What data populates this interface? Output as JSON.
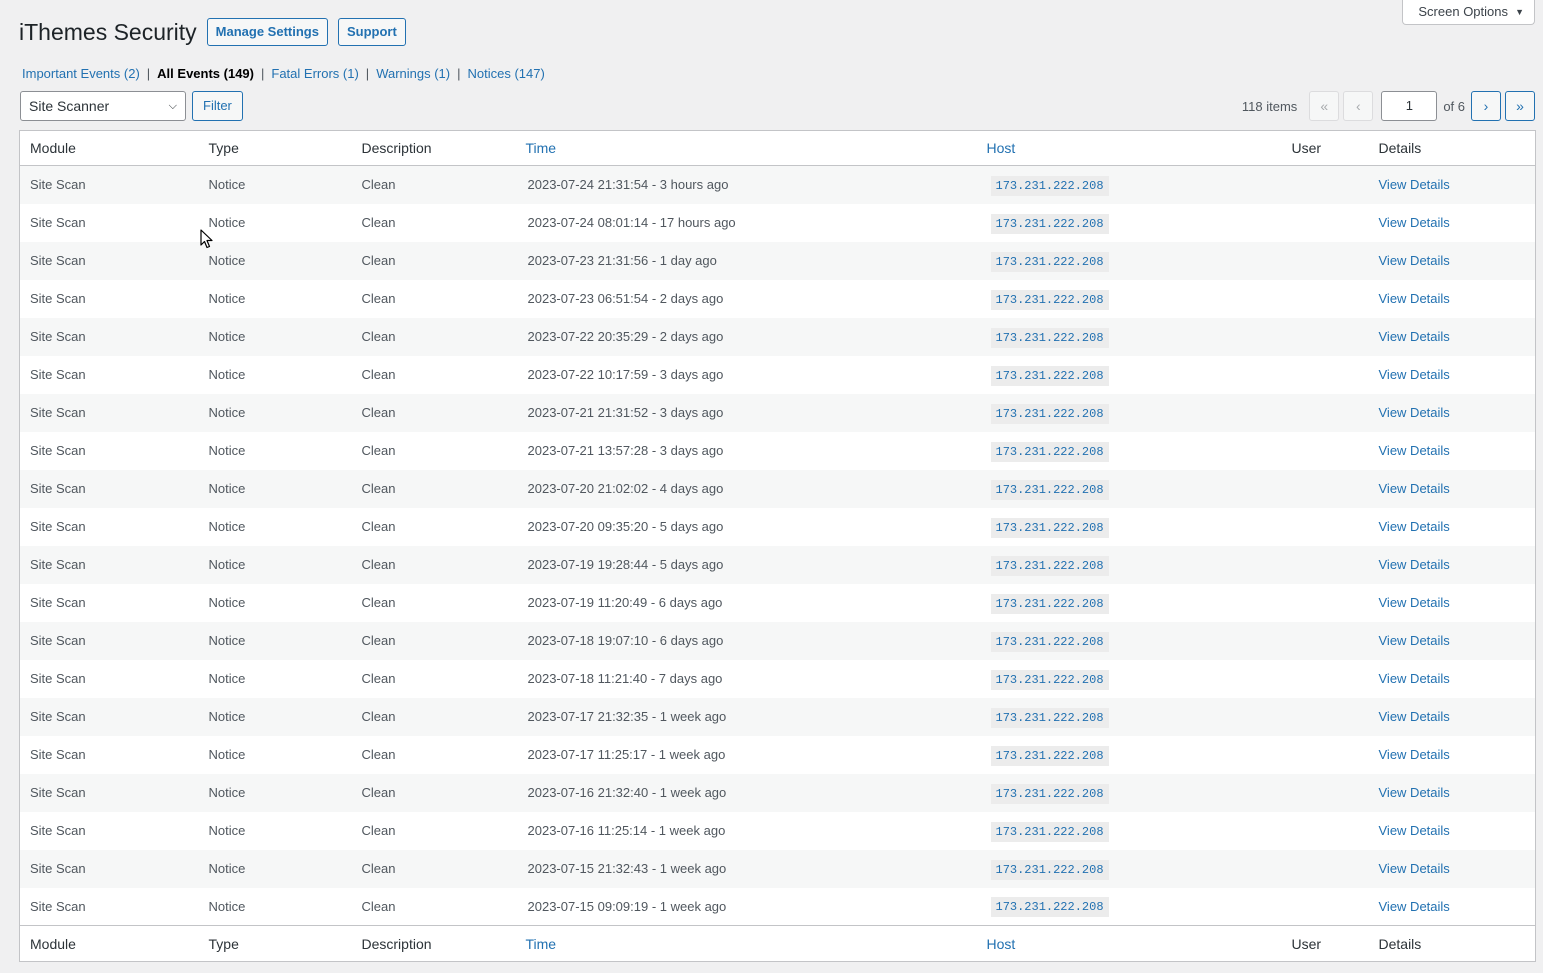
{
  "screen_options": {
    "label": "Screen Options",
    "caret": "▼"
  },
  "header": {
    "title": "iThemes Security",
    "manage_settings": "Manage Settings",
    "support": "Support"
  },
  "views": [
    {
      "label": "Important Events (2)",
      "current": false
    },
    {
      "label": "All Events (149)",
      "current": true
    },
    {
      "label": "Fatal Errors (1)",
      "current": false
    },
    {
      "label": "Warnings (1)",
      "current": false
    },
    {
      "label": "Notices (147)",
      "current": false
    }
  ],
  "filter": {
    "select_value": "Site Scanner",
    "button": "Filter"
  },
  "pagination": {
    "items": "118 items",
    "first": "«",
    "prev": "‹",
    "current_page": "1",
    "of_total": "of 6",
    "next": "›",
    "last": "»"
  },
  "columns": [
    "Module",
    "Type",
    "Description",
    "Time",
    "Host",
    "User",
    "Details"
  ],
  "rows": [
    {
      "module": "Site Scan",
      "type": "Notice",
      "description": "Clean",
      "time": "2023-07-24 21:31:54 - 3 hours ago",
      "host": "173.231.222.208",
      "user": "",
      "details": "View Details"
    },
    {
      "module": "Site Scan",
      "type": "Notice",
      "description": "Clean",
      "time": "2023-07-24 08:01:14 - 17 hours ago",
      "host": "173.231.222.208",
      "user": "",
      "details": "View Details"
    },
    {
      "module": "Site Scan",
      "type": "Notice",
      "description": "Clean",
      "time": "2023-07-23 21:31:56 - 1 day ago",
      "host": "173.231.222.208",
      "user": "",
      "details": "View Details"
    },
    {
      "module": "Site Scan",
      "type": "Notice",
      "description": "Clean",
      "time": "2023-07-23 06:51:54 - 2 days ago",
      "host": "173.231.222.208",
      "user": "",
      "details": "View Details"
    },
    {
      "module": "Site Scan",
      "type": "Notice",
      "description": "Clean",
      "time": "2023-07-22 20:35:29 - 2 days ago",
      "host": "173.231.222.208",
      "user": "",
      "details": "View Details"
    },
    {
      "module": "Site Scan",
      "type": "Notice",
      "description": "Clean",
      "time": "2023-07-22 10:17:59 - 3 days ago",
      "host": "173.231.222.208",
      "user": "",
      "details": "View Details"
    },
    {
      "module": "Site Scan",
      "type": "Notice",
      "description": "Clean",
      "time": "2023-07-21 21:31:52 - 3 days ago",
      "host": "173.231.222.208",
      "user": "",
      "details": "View Details"
    },
    {
      "module": "Site Scan",
      "type": "Notice",
      "description": "Clean",
      "time": "2023-07-21 13:57:28 - 3 days ago",
      "host": "173.231.222.208",
      "user": "",
      "details": "View Details"
    },
    {
      "module": "Site Scan",
      "type": "Notice",
      "description": "Clean",
      "time": "2023-07-20 21:02:02 - 4 days ago",
      "host": "173.231.222.208",
      "user": "",
      "details": "View Details"
    },
    {
      "module": "Site Scan",
      "type": "Notice",
      "description": "Clean",
      "time": "2023-07-20 09:35:20 - 5 days ago",
      "host": "173.231.222.208",
      "user": "",
      "details": "View Details"
    },
    {
      "module": "Site Scan",
      "type": "Notice",
      "description": "Clean",
      "time": "2023-07-19 19:28:44 - 5 days ago",
      "host": "173.231.222.208",
      "user": "",
      "details": "View Details"
    },
    {
      "module": "Site Scan",
      "type": "Notice",
      "description": "Clean",
      "time": "2023-07-19 11:20:49 - 6 days ago",
      "host": "173.231.222.208",
      "user": "",
      "details": "View Details"
    },
    {
      "module": "Site Scan",
      "type": "Notice",
      "description": "Clean",
      "time": "2023-07-18 19:07:10 - 6 days ago",
      "host": "173.231.222.208",
      "user": "",
      "details": "View Details"
    },
    {
      "module": "Site Scan",
      "type": "Notice",
      "description": "Clean",
      "time": "2023-07-18 11:21:40 - 7 days ago",
      "host": "173.231.222.208",
      "user": "",
      "details": "View Details"
    },
    {
      "module": "Site Scan",
      "type": "Notice",
      "description": "Clean",
      "time": "2023-07-17 21:32:35 - 1 week ago",
      "host": "173.231.222.208",
      "user": "",
      "details": "View Details"
    },
    {
      "module": "Site Scan",
      "type": "Notice",
      "description": "Clean",
      "time": "2023-07-17 11:25:17 - 1 week ago",
      "host": "173.231.222.208",
      "user": "",
      "details": "View Details"
    },
    {
      "module": "Site Scan",
      "type": "Notice",
      "description": "Clean",
      "time": "2023-07-16 21:32:40 - 1 week ago",
      "host": "173.231.222.208",
      "user": "",
      "details": "View Details"
    },
    {
      "module": "Site Scan",
      "type": "Notice",
      "description": "Clean",
      "time": "2023-07-16 11:25:14 - 1 week ago",
      "host": "173.231.222.208",
      "user": "",
      "details": "View Details"
    },
    {
      "module": "Site Scan",
      "type": "Notice",
      "description": "Clean",
      "time": "2023-07-15 21:32:43 - 1 week ago",
      "host": "173.231.222.208",
      "user": "",
      "details": "View Details"
    },
    {
      "module": "Site Scan",
      "type": "Notice",
      "description": "Clean",
      "time": "2023-07-15 09:09:19 - 1 week ago",
      "host": "173.231.222.208",
      "user": "",
      "details": "View Details"
    }
  ],
  "colors": {
    "link": "#2271b1",
    "background": "#f0f0f1",
    "border": "#c3c4c7"
  }
}
